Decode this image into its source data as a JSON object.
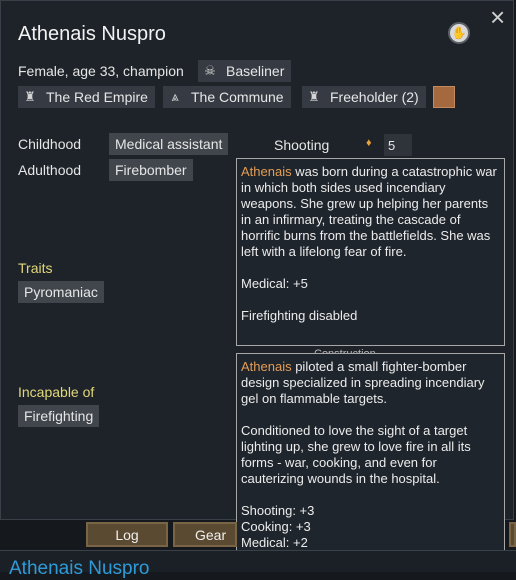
{
  "colonist": {
    "name": "Athenais Nuspro",
    "description": "Female, age 33, champion",
    "xenotype": "Baseliner",
    "short_name": "Athenais"
  },
  "window": {
    "close_icon": "×"
  },
  "factions": [
    {
      "label": "The Red Empire",
      "icon": "tower-icon"
    },
    {
      "label": "The Commune",
      "icon": "chevron-icon"
    },
    {
      "label": "Freeholder (2)",
      "icon": "tower-icon"
    }
  ],
  "favorite_color": "#a4693e",
  "backstory": {
    "childhood_label": "Childhood",
    "childhood_value": "Medical assistant",
    "adulthood_label": "Adulthood",
    "adulthood_value": "Firebomber"
  },
  "skill": {
    "name": "Shooting",
    "value": "5"
  },
  "traits": {
    "header": "Traits",
    "items": [
      "Pyromaniac"
    ]
  },
  "incapable": {
    "header": "Incapable of",
    "items": [
      "Firefighting"
    ]
  },
  "tooltip_childhood": {
    "body": " was born during a catastrophic war in which both sides used incendiary weapons. She grew up helping her parents in an infirmary, treating the cascade of horrific burns from the battlefields. She was left with a lifelong fear of fire.",
    "lines": [
      "Medical: +5",
      "Firefighting disabled"
    ]
  },
  "tooltip_adulthood": {
    "body1": " piloted a small fighter-bomber design specialized in spreading incendiary gel on flammable targets.",
    "body2": "Conditioned to love the sight of a target lighting up, she grew to love fire in all its forms - war, cooking, and even for cauterizing wounds in the hospital.",
    "lines": [
      "Shooting: +3",
      "Cooking: +3",
      "Medical: +2"
    ]
  },
  "obscured_text": "Construction",
  "tabs": {
    "log": "Log",
    "gear": "Gear"
  },
  "bottom": {
    "name": "Athenais Nuspro"
  }
}
